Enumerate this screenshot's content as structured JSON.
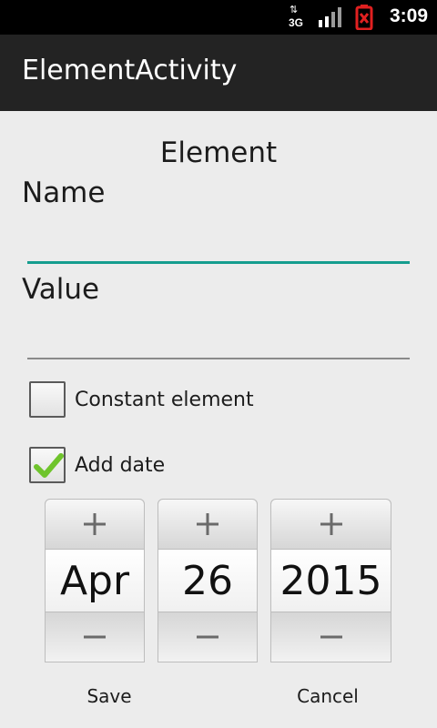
{
  "status_bar": {
    "time": "3:09",
    "network_label": "3G",
    "icons": [
      "network-3g-icon",
      "signal-icon",
      "battery-alert-icon"
    ],
    "battery_color": "#e02020"
  },
  "action_bar": {
    "title": "ElementActivity"
  },
  "form": {
    "heading": "Element",
    "name_label": "Name",
    "name_value": "",
    "value_label": "Value",
    "value_value": "",
    "accent_color": "#149d8e",
    "constant_checkbox": {
      "label": "Constant element",
      "checked": false
    },
    "add_date_checkbox": {
      "label": "Add date",
      "checked": true
    }
  },
  "date_picker": {
    "month": "Apr",
    "day": "26",
    "year": "2015",
    "increment_symbol": "+",
    "decrement_symbol": "−"
  },
  "buttons": {
    "save": "Save",
    "cancel": "Cancel"
  }
}
